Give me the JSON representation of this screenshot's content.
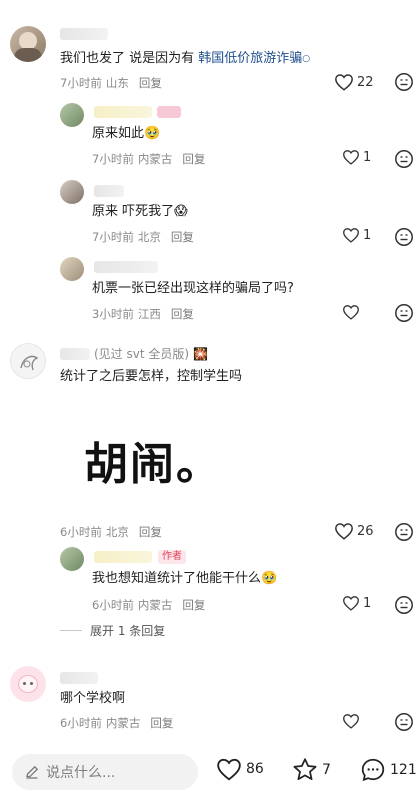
{
  "comments": [
    {
      "text": "我们也发了 说是因为有",
      "link": "韩国低价旅游诈骗",
      "time": "7小时前",
      "location": "山东",
      "reply_label": "回复",
      "likes": "22",
      "replies": [
        {
          "text": "原来如此",
          "emoji": "🥹",
          "time": "7小时前",
          "location": "内蒙古",
          "reply_label": "回复",
          "likes": "1"
        },
        {
          "text": "原来 吓死我了",
          "emoji": "😱",
          "time": "7小时前",
          "location": "北京",
          "reply_label": "回复",
          "likes": "1"
        },
        {
          "text": "机票一张已经出现这样的骗局了吗?",
          "time": "3小时前",
          "location": "江西",
          "reply_label": "回复",
          "likes": ""
        }
      ]
    },
    {
      "user_suffix": "(见过 svt 全员版)",
      "badge": "🎇",
      "text": "统计了之后要怎样，控制学生吗",
      "big_text": "胡闹。",
      "time": "6小时前",
      "location": "北京",
      "reply_label": "回复",
      "likes": "26",
      "replies": [
        {
          "author_tag": "作者",
          "text": "我也想知道统计了他能干什么",
          "emoji": "🥹",
          "time": "6小时前",
          "location": "内蒙古",
          "reply_label": "回复",
          "likes": "1"
        }
      ],
      "expand_label": "展开 1 条回复"
    },
    {
      "text": "哪个学校啊",
      "time": "6小时前",
      "location": "内蒙古",
      "reply_label": "回复",
      "likes": ""
    }
  ],
  "bottom_bar": {
    "input_placeholder": "说点什么...",
    "likes": "86",
    "stars": "7",
    "comments": "121"
  }
}
